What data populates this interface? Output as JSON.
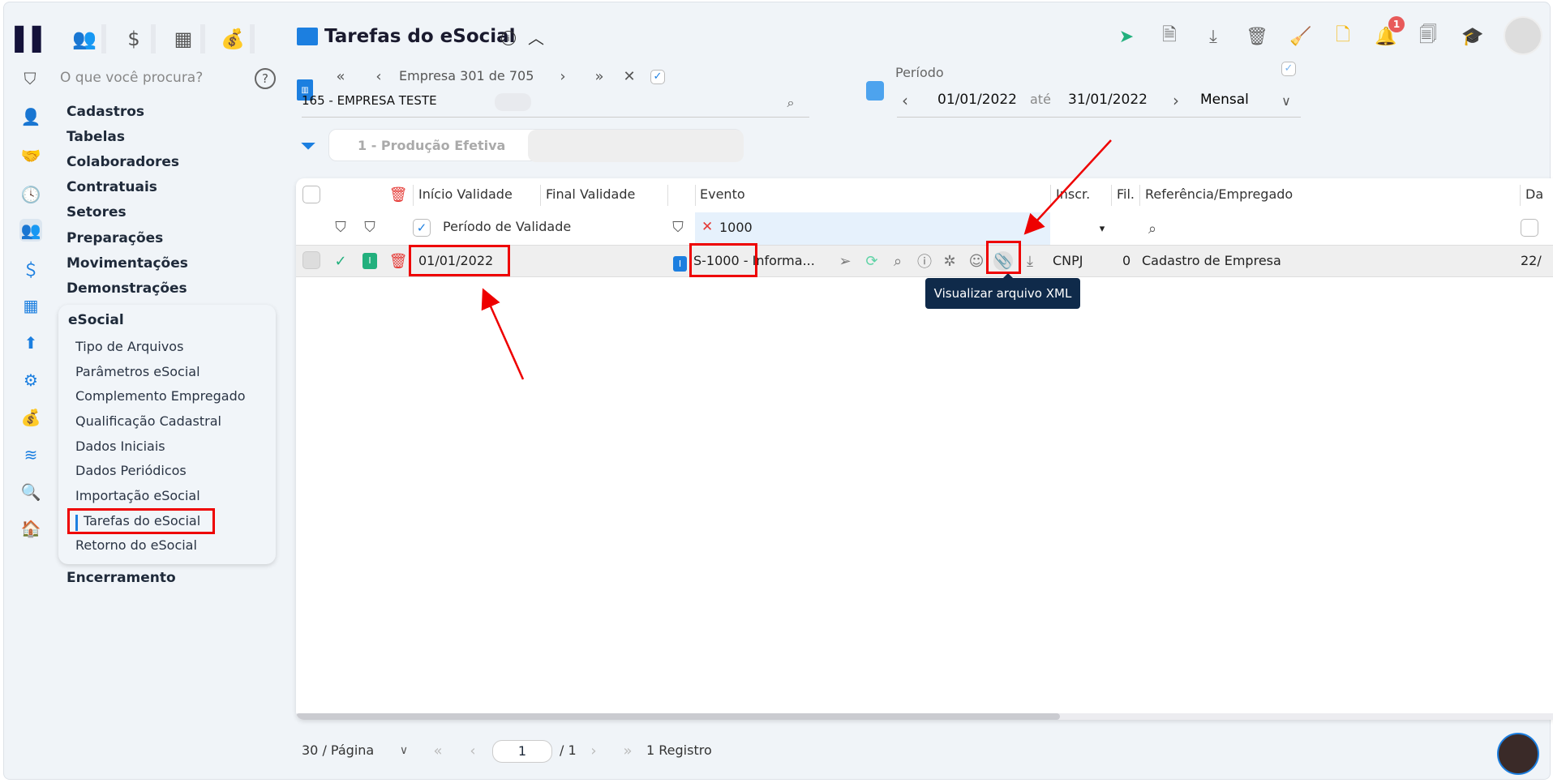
{
  "header": {
    "title": "Tarefas do eSocial",
    "notification_count": "1"
  },
  "search": {
    "placeholder": "O que você procura?"
  },
  "sidebar": {
    "items": [
      "Cadastros",
      "Tabelas",
      "Colaboradores",
      "Contratuais",
      "Setores",
      "Preparações",
      "Movimentações",
      "Demonstrações"
    ],
    "esocial_group": {
      "title": "eSocial",
      "items": [
        "Tipo de Arquivos",
        "Parâmetros eSocial",
        "Complemento Empregado",
        "Qualificação Cadastral",
        "Dados Iniciais",
        "Dados Periódicos",
        "Importação eSocial",
        "Tarefas do eSocial",
        "Retorno do eSocial"
      ]
    },
    "last_item": "Encerramento"
  },
  "empresa": {
    "nav_label": "Empresa 301 de 705",
    "name": "165 - EMPRESA TESTE"
  },
  "periodo": {
    "label": "Período",
    "start": "01/01/2022",
    "sep": "até",
    "end": "31/01/2022",
    "mode": "Mensal"
  },
  "filter_chip": "1 - Produção Efetiva",
  "table": {
    "columns": [
      "Início Validade",
      "Final Validade",
      "Evento",
      "Inscr.",
      "Fil.",
      "Referência/Empregado",
      "Da"
    ],
    "filter": {
      "periodo_label": "Período de Validade",
      "evento_value": "1000"
    },
    "rows": [
      {
        "status_badge": "I",
        "inicio": "01/01/2022",
        "evento_badge": "I",
        "evento": "S-1000 - Informa...",
        "inscr": "CNPJ",
        "fil": "0",
        "referencia": "Cadastro de Empresa",
        "data": "22/"
      }
    ],
    "tooltip": "Visualizar arquivo XML"
  },
  "footer": {
    "page_size": "30 / Página",
    "page": "1",
    "total_pages": "/ 1",
    "records": "1 Registro"
  },
  "colors": {
    "accent": "#1c7fe0",
    "success": "#22b07d",
    "danger": "#e53935",
    "tooltip_bg": "#0f2a4a"
  }
}
